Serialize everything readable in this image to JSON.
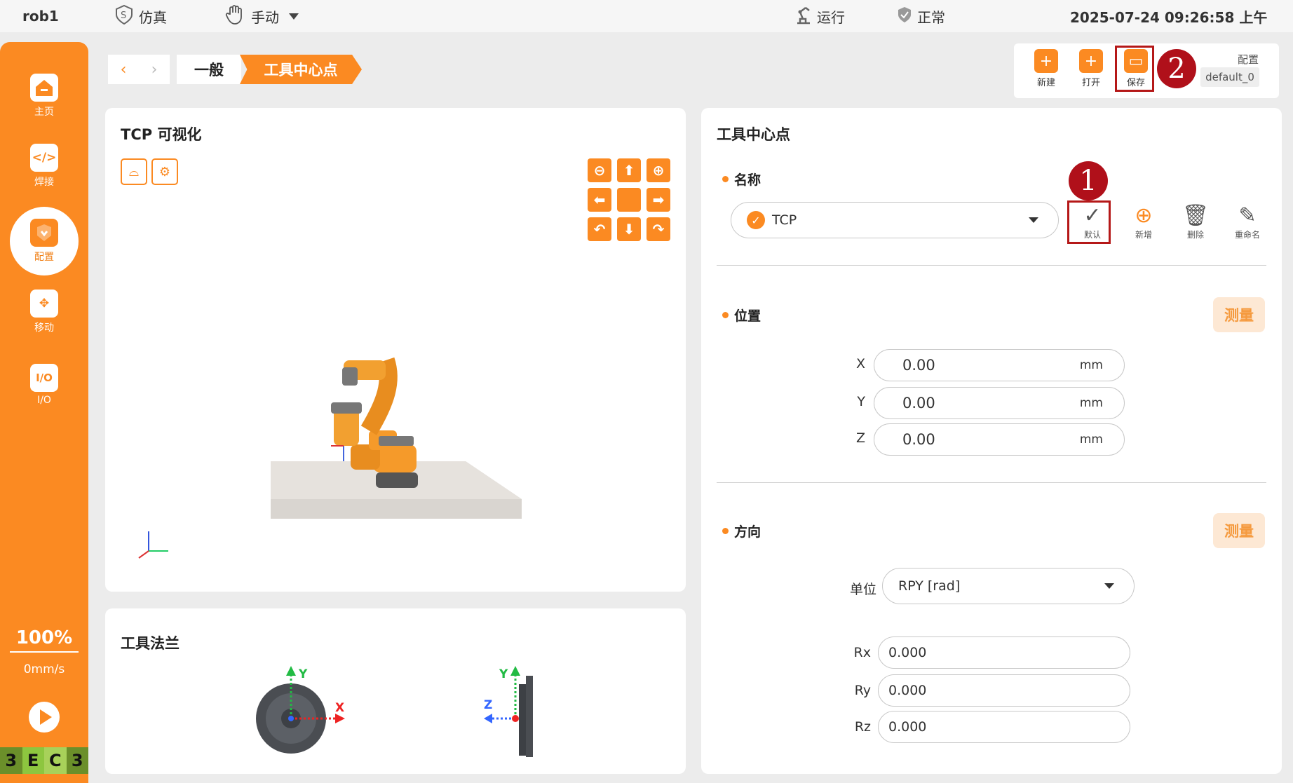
{
  "topbar": {
    "robot_name": "rob1",
    "sim_label": "仿真",
    "mode_label": "手动",
    "run_label": "运行",
    "status_label": "正常",
    "datetime": "2025-07-24 09:26:58 上午"
  },
  "sidebar": {
    "items": [
      {
        "label": "主页",
        "icon": "home-icon"
      },
      {
        "label": "焊接",
        "icon": "code-icon"
      },
      {
        "label": "配置",
        "icon": "config-icon"
      },
      {
        "label": "移动",
        "icon": "move-icon"
      },
      {
        "label": "I/O",
        "icon": "io-icon"
      }
    ],
    "speed_percent": "100%",
    "speed_value": "0mm/s",
    "badge": [
      "3",
      "E",
      "C",
      "3"
    ],
    "accent": "#fb8a22"
  },
  "breadcrumb": {
    "general": "一般",
    "current": "工具中心点"
  },
  "filebar": {
    "new_label": "新建",
    "open_label": "打开",
    "save_label": "保存",
    "config_label": "配置",
    "config_value": "default_0"
  },
  "markers": {
    "one": "1",
    "two": "2"
  },
  "viz": {
    "title": "TCP 可视化"
  },
  "flange": {
    "title": "工具法兰",
    "axis_x": "X",
    "axis_y": "Y",
    "axis_z": "Z"
  },
  "tcp": {
    "title": "工具中心点",
    "name_section": "名称",
    "selected": "TCP",
    "actions": {
      "default": "默认",
      "new": "新增",
      "delete": "删除",
      "rename": "重命名"
    },
    "position_section": "位置",
    "measure_label": "测量",
    "position": [
      {
        "label": "X",
        "value": "0.00",
        "unit": "mm"
      },
      {
        "label": "Y",
        "value": "0.00",
        "unit": "mm"
      },
      {
        "label": "Z",
        "value": "0.00",
        "unit": "mm"
      }
    ],
    "orientation_section": "方向",
    "unit_label": "单位",
    "unit_value": "RPY [rad]",
    "orientation": [
      {
        "label": "Rx",
        "value": "0.000"
      },
      {
        "label": "Ry",
        "value": "0.000"
      },
      {
        "label": "Rz",
        "value": "0.000"
      }
    ]
  }
}
